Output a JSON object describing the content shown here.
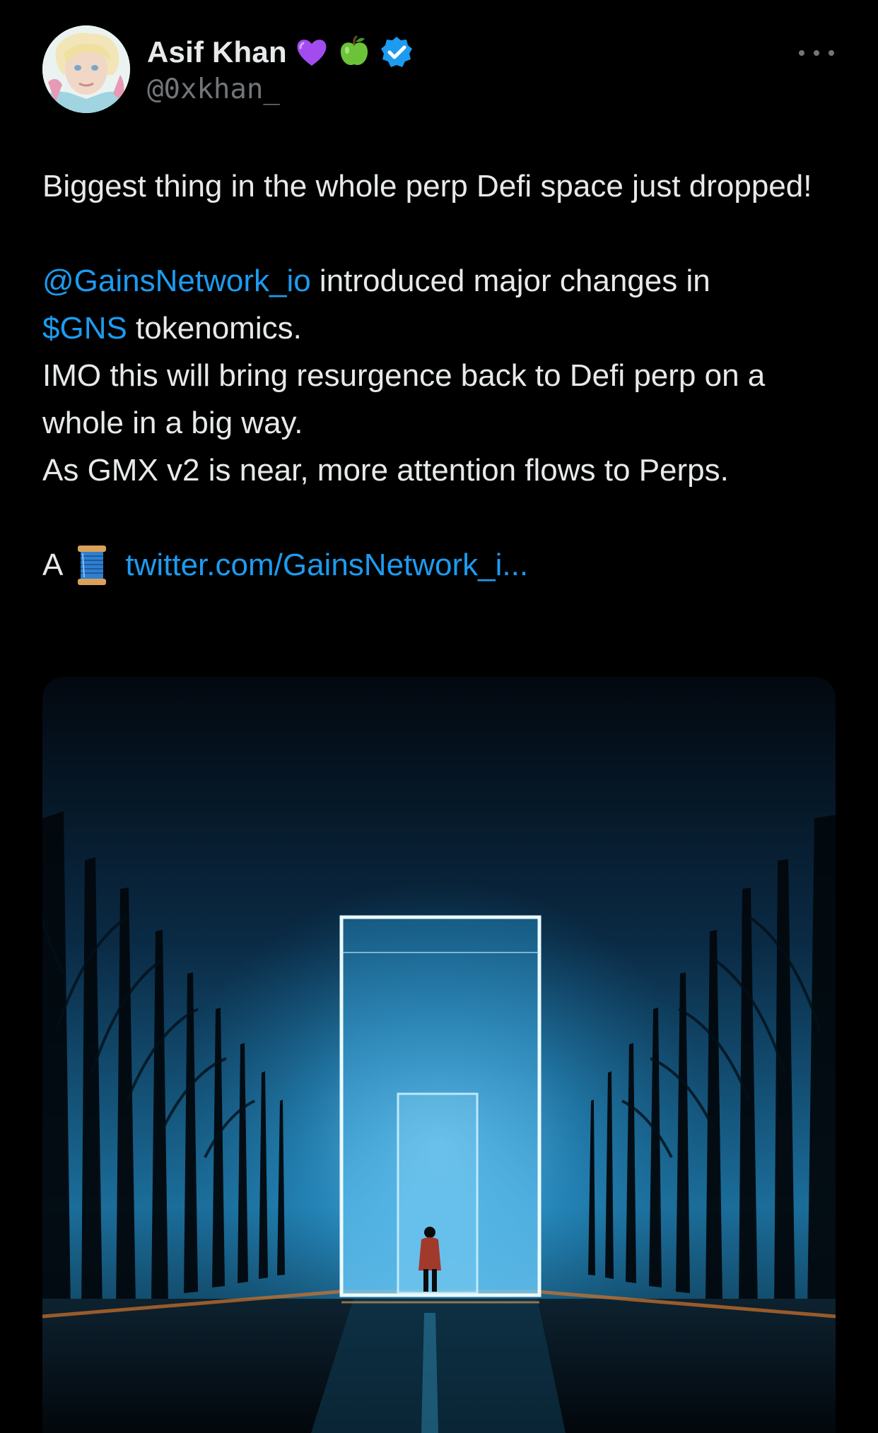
{
  "author": {
    "display_name": "Asif Khan",
    "handle": "@0xkhan_",
    "badges": [
      "purple-heart-icon",
      "green-apple-icon",
      "verified-badge-icon"
    ],
    "verified_color": "#1d9bf0"
  },
  "tweet": {
    "line1": "Biggest thing in the whole perp Defi space just dropped!",
    "mention": "@GainsNetwork_io",
    "after_mention": " introduced major changes in",
    "cashtag": "$GNS",
    "after_cashtag": " tokenomics.",
    "line_imo": "IMO this will bring resurgence back to Defi perp on a whole in a big way.",
    "line_gmx": "As GMX v2 is near, more attention flows to Perps.",
    "thread_prefix": "A",
    "thread_icon": "spool-of-thread-icon",
    "link_text": "twitter.com/GainsNetwork_i..."
  },
  "colors": {
    "background": "#000000",
    "text": "#e7e9ea",
    "secondary": "#71767b",
    "link": "#1d9bf0"
  },
  "media": {
    "description_icon": "glowing-portal-image"
  }
}
